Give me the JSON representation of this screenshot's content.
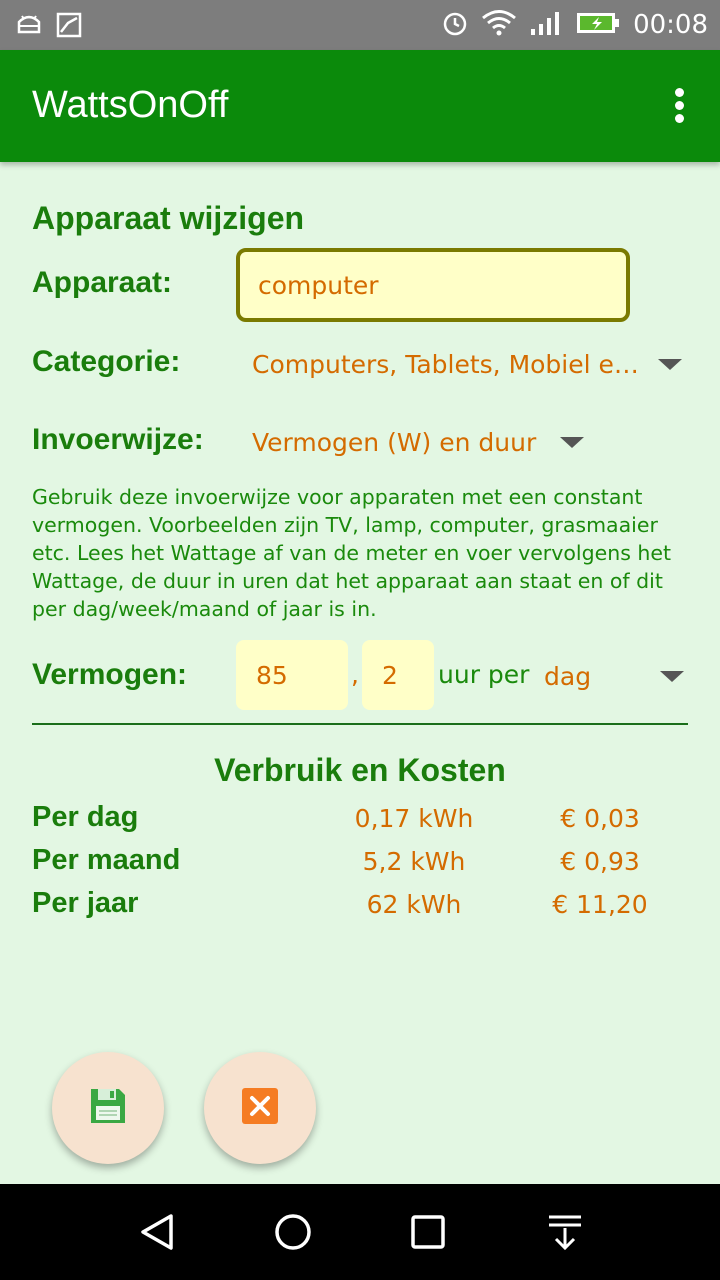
{
  "status_bar": {
    "time": "00:08",
    "icons": [
      "android-icon",
      "image-icon",
      "alarm-icon",
      "wifi-icon",
      "signal-icon",
      "battery-charging-icon"
    ]
  },
  "app_bar": {
    "title": "WattsOnOff",
    "menu_icon": "overflow-menu-icon"
  },
  "form": {
    "section_title": "Apparaat wijzigen",
    "device_label": "Apparaat:",
    "device_value": "computer",
    "category_label": "Categorie:",
    "category_value": "Computers, Tablets, Mobiel e…",
    "input_mode_label": "Invoerwijze:",
    "input_mode_value": "Vermogen (W) en duur",
    "help_text": "Gebruik deze invoerwijze voor apparaten met een constant vermogen. Voorbeelden zijn TV, lamp, computer, grasmaaier etc. Lees het Wattage af van de meter en voer vervolgens het Wattage, de duur in uren dat het apparaat aan staat en of dit per dag/week/maand of jaar is in.",
    "power_label": "Vermogen:",
    "power_value": "85",
    "separator": ",",
    "hours_value": "2",
    "hours_suffix": "uur per",
    "period_value": "dag"
  },
  "results": {
    "title": "Verbruik en Kosten",
    "rows": [
      {
        "label": "Per dag",
        "kwh": "0,17 kWh",
        "cost": "€ 0,03"
      },
      {
        "label": "Per maand",
        "kwh": "5,2 kWh",
        "cost": "€ 0,93"
      },
      {
        "label": "Per jaar",
        "kwh": "62 kWh",
        "cost": "€ 11,20"
      }
    ]
  },
  "actions": {
    "save_icon": "save-icon",
    "cancel_icon": "cancel-icon"
  },
  "nav_bar": {
    "icons": [
      "back-icon",
      "home-icon",
      "recents-icon",
      "notifications-pull-icon"
    ]
  },
  "colors": {
    "app_bar": "#0b8a0b",
    "background": "#e3f7e3",
    "label_green": "#1a7d0c",
    "value_orange": "#d46b00",
    "input_bg": "#ffffc8",
    "fab_bg": "#f7e2cf"
  }
}
